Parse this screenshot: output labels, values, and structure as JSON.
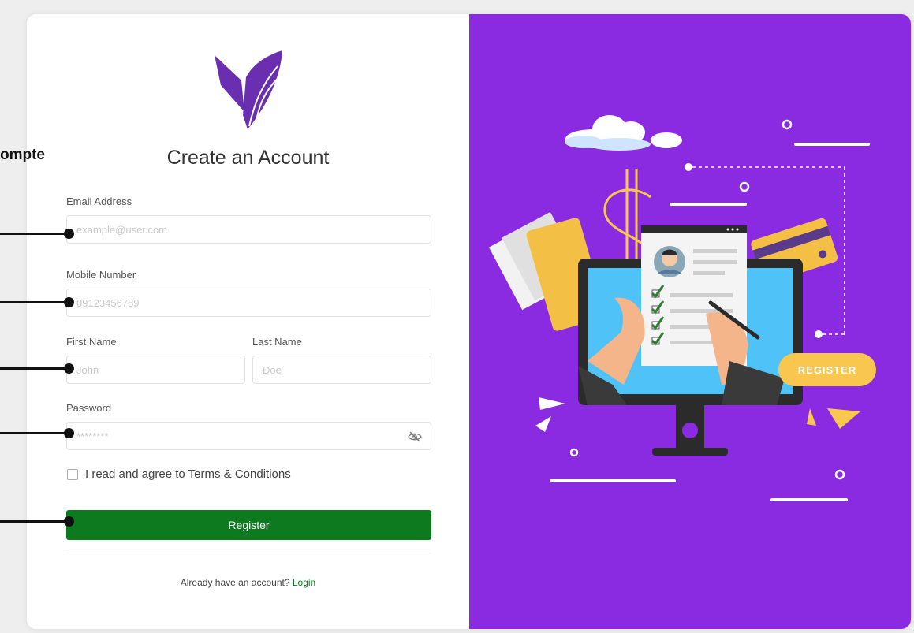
{
  "annotation": {
    "partial_label": "ompte"
  },
  "form": {
    "title": "Create an Account",
    "email": {
      "label": "Email Address",
      "placeholder": "example@user.com"
    },
    "mobile": {
      "label": "Mobile Number",
      "placeholder": "09123456789"
    },
    "first_name": {
      "label": "First Name",
      "placeholder": "John"
    },
    "last_name": {
      "label": "Last Name",
      "placeholder": "Doe"
    },
    "password": {
      "label": "Password",
      "placeholder": "********"
    },
    "terms_label": "I read and agree to Terms & Conditions",
    "register_label": "Register",
    "footer_text": "Already have an account?",
    "login_link": "Login"
  },
  "illustration": {
    "badge_text": "REGISTER",
    "icons": [
      "logo-leaf-icon",
      "eye-off-icon",
      "dollar-sign-icon",
      "cloud-icon",
      "credit-card-icon",
      "monitor-icon",
      "checkmark-icon",
      "pen-icon",
      "avatar-icon"
    ]
  },
  "colors": {
    "brand_purple": "#8a2be2",
    "register_green": "#0e7a1f",
    "badge_yellow": "#f9c74f"
  }
}
